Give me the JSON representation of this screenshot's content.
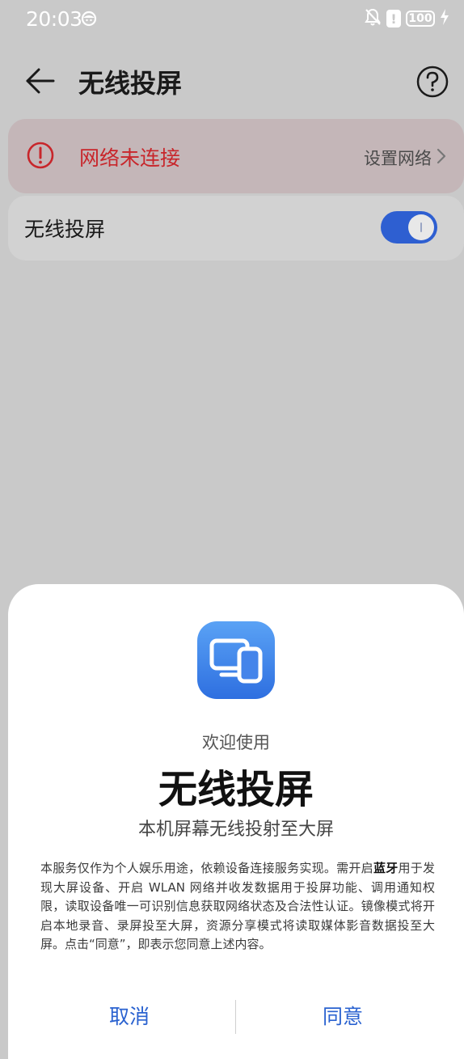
{
  "status_bar": {
    "time": "20:03",
    "battery": "100",
    "icons": [
      "face-icon",
      "mute-bell-icon",
      "alert-icon",
      "battery-icon",
      "charging-icon"
    ]
  },
  "header": {
    "title": "无线投屏",
    "back_icon": "back-arrow-icon",
    "help_icon": "help-icon"
  },
  "network": {
    "status": "网络未连接",
    "action": "设置网络",
    "status_color": "#c8262b"
  },
  "wireless_toggle": {
    "label": "无线投屏",
    "enabled": true,
    "accent": "#2e5fd1"
  },
  "dialog": {
    "welcome": "欢迎使用",
    "title": "无线投屏",
    "subtitle": "本机屏幕无线投射至大屏",
    "disclaimer_part1": "本服务仅作为个人娱乐用途，依赖设备连接服务实现。需开启",
    "disclaimer_bold": "蓝牙",
    "disclaimer_part2": "用于发现大屏设备、开启 WLAN 网络并收发数据用于投屏功能、调用通知权限，读取设备唯一可识别信息获取网络状态及合法性认证。镜像模式将开启本地录音、录屏投至大屏，资源分享模式将读取媒体影音数据投至大屏。点击“同意”，即表示您同意上述内容。",
    "cancel_label": "取消",
    "agree_label": "同意",
    "app_icon": "screen-cast-icon",
    "button_color": "#2a62d0"
  }
}
